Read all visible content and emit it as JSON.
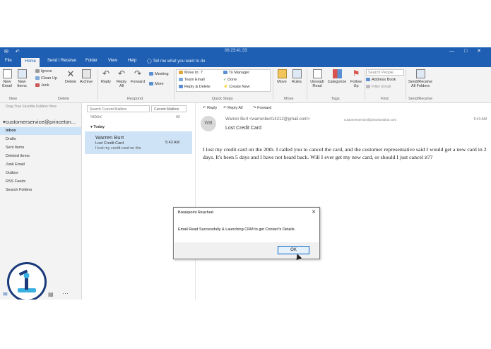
{
  "titlebar": {
    "window_title": "06:23:41:33"
  },
  "tabs": [
    {
      "label": "File"
    },
    {
      "label": "Home"
    },
    {
      "label": "Send / Receive"
    },
    {
      "label": "Folder"
    },
    {
      "label": "View"
    },
    {
      "label": "Help"
    }
  ],
  "tell_me": "Tell me what you want to do",
  "ribbon": {
    "new_email": "New Email",
    "new_items": "New Items",
    "ignore": "Ignore",
    "clean_up": "Clean Up",
    "junk": "Junk",
    "delete": "Delete",
    "archive": "Archive",
    "reply": "Reply",
    "reply_all": "Reply All",
    "forward": "Forward",
    "meeting": "Meeting",
    "more": "More",
    "quick_steps": [
      "Move to: ?",
      "Team Email",
      "Reply & Delete",
      "To Manager",
      "Done",
      "Create New"
    ],
    "move": "Move",
    "rules": "Rules",
    "unread_read": "Unread/ Read",
    "categorize": "Categorize",
    "follow_up": "Follow Up",
    "search_people": "Search People",
    "address_book": "Address Book",
    "filter_email": "Filter Email",
    "send_receive_all": "Send/Receive All Folders",
    "groups": [
      "New",
      "Delete",
      "Respond",
      "Quick Steps",
      "Move",
      "Tags",
      "Find",
      "Send/Receive"
    ]
  },
  "folders": {
    "fav_hint": "Drag Your Favorite Folders Here",
    "account": "customerservice@princeton...",
    "items": [
      "Inbox",
      "Drafts",
      "Sent Items",
      "Deleted Items",
      "Junk Email",
      "Outbox",
      "RSS Feeds",
      "Search Folders"
    ]
  },
  "msglist": {
    "search_placeholder": "Search Current Mailbox",
    "scope": "Current Mailbox",
    "folder_label": "Inbox",
    "filter": "All",
    "group": "Today",
    "message": {
      "from": "Warren Burt",
      "subject": "Lost Credit Card",
      "preview": "I lost my credit card on the",
      "time": "5:43 AM"
    }
  },
  "reading": {
    "actions": [
      "Reply",
      "Reply All",
      "Forward"
    ],
    "initials": "WB",
    "from": "Warren Burt <warrenburt14212@gmail.com>",
    "to": "customerservice@princetonblue.com",
    "time": "5:43 AM",
    "subject": "Lost Credit Card",
    "body": "I lost my credit card on the 20th. I called you to cancel the card, and the customer representative said I would get a new card in 2 days. It's been 5 days and I have not heard back. Will I ever get my new card, or should I just cancel it??"
  },
  "dialog": {
    "title": "Breakpoint Reached",
    "message": "Email Read Successfully & Launching CRM to get Contact's Details.",
    "ok": "OK"
  },
  "colors": {
    "accent": "#1e5fb3",
    "selection": "#cde3f7"
  }
}
